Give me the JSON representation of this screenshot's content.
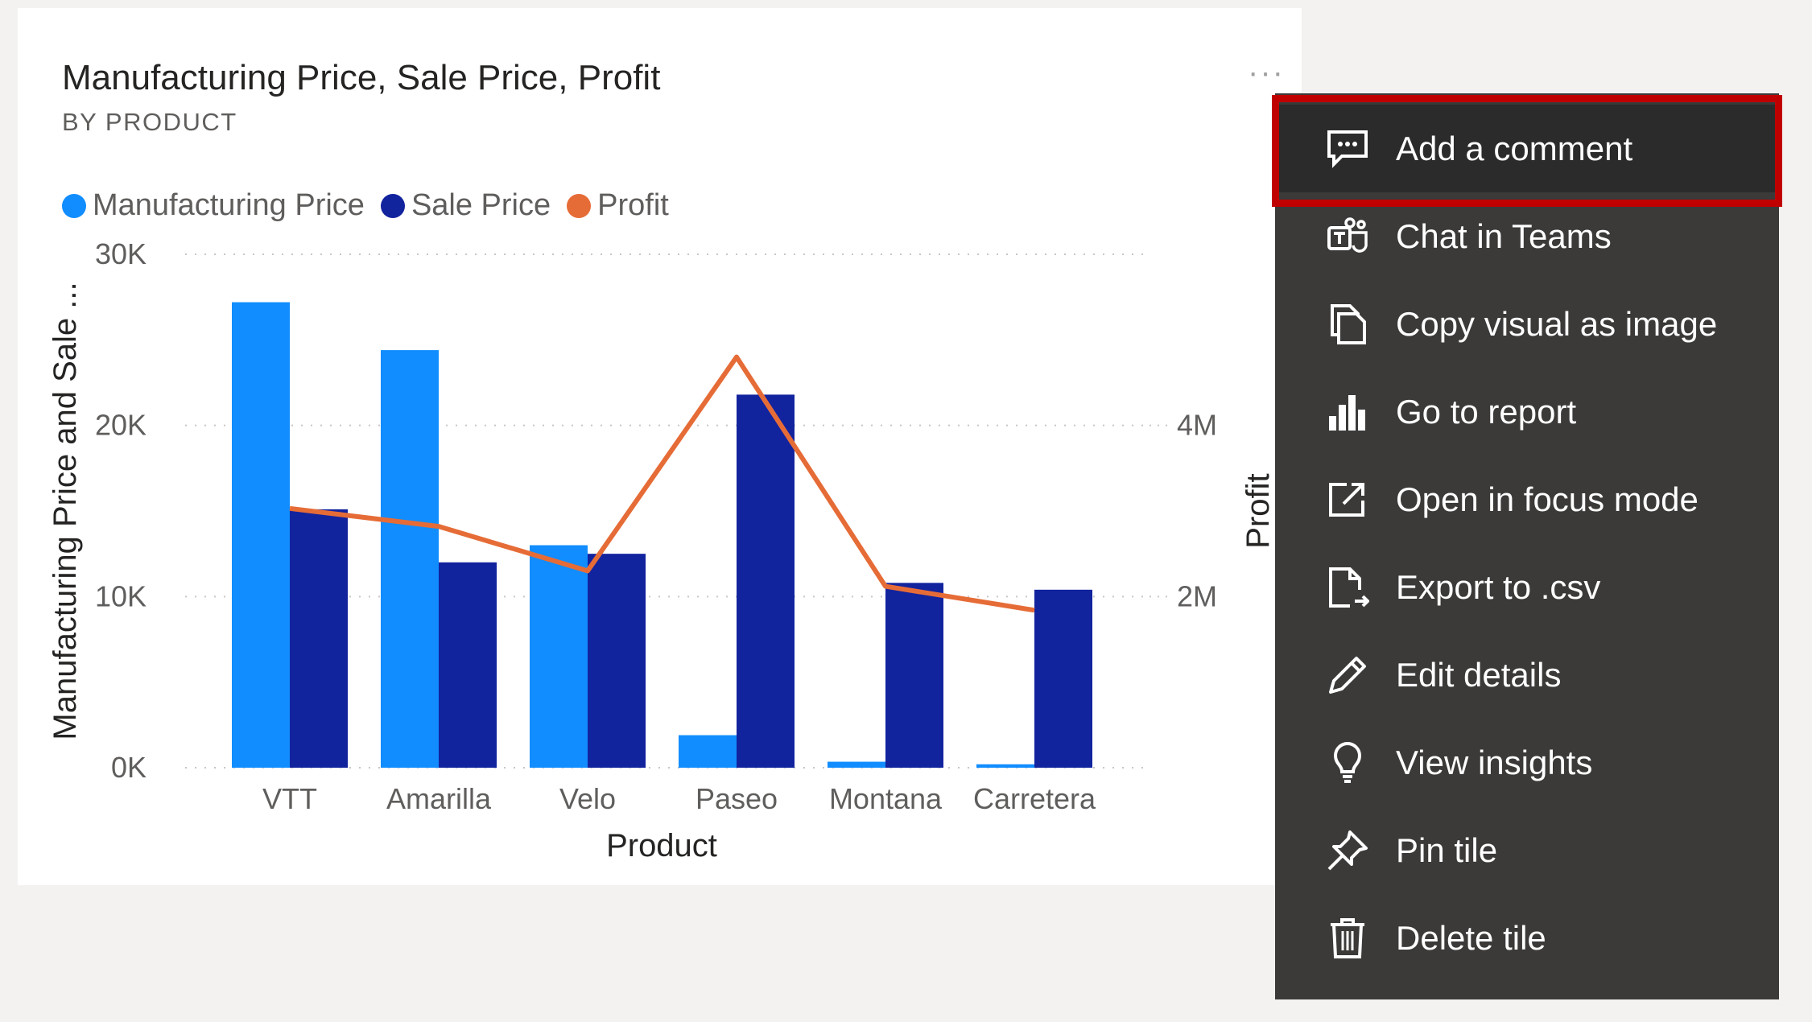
{
  "tile": {
    "title": "Manufacturing Price, Sale Price, Profit",
    "subtitle": "BY PRODUCT",
    "more_label": "···"
  },
  "legend": [
    {
      "name": "Manufacturing Price",
      "color": "#118dff"
    },
    {
      "name": "Sale Price",
      "color": "#12239e"
    },
    {
      "name": "Profit",
      "color": "#e66c37"
    }
  ],
  "chart_data": {
    "type": "bar",
    "categories": [
      "VTT",
      "Amarilla",
      "Velo",
      "Paseo",
      "Montana",
      "Carretera"
    ],
    "series": [
      {
        "name": "Manufacturing Price",
        "type": "bar",
        "axis": "left",
        "values": [
          27200,
          24400,
          13000,
          1900,
          350,
          200
        ]
      },
      {
        "name": "Sale Price",
        "type": "bar",
        "axis": "left",
        "values": [
          15100,
          12000,
          12500,
          21800,
          10800,
          10400
        ]
      },
      {
        "name": "Profit",
        "type": "line",
        "axis": "right",
        "values": [
          3030000,
          2820000,
          2300000,
          4800000,
          2120000,
          1840000
        ]
      }
    ],
    "xlabel": "Product",
    "ylabel": "Manufacturing Price and Sale ...",
    "y2label": "Profit",
    "ylim": [
      0,
      30000
    ],
    "y2lim": [
      0,
      6000000
    ],
    "yticks": [
      "0K",
      "10K",
      "20K",
      "30K"
    ],
    "y2ticks": [
      "2M",
      "4M"
    ],
    "grid": true,
    "legend_position": "top-left",
    "colors": {
      "manufacturing": "#118dff",
      "sale": "#12239e",
      "profit": "#e66c37"
    }
  },
  "menu": {
    "items": [
      {
        "label": "Add a comment",
        "icon": "comment-icon"
      },
      {
        "label": "Chat in Teams",
        "icon": "teams-icon"
      },
      {
        "label": "Copy visual as image",
        "icon": "copy-icon"
      },
      {
        "label": "Go to report",
        "icon": "report-icon"
      },
      {
        "label": "Open in focus mode",
        "icon": "focus-mode-icon"
      },
      {
        "label": "Export to .csv",
        "icon": "export-icon"
      },
      {
        "label": "Edit details",
        "icon": "pencil-icon"
      },
      {
        "label": "View insights",
        "icon": "lightbulb-icon"
      },
      {
        "label": "Pin tile",
        "icon": "pin-icon"
      },
      {
        "label": "Delete tile",
        "icon": "trash-icon"
      }
    ],
    "highlight_color": "#c00000"
  }
}
